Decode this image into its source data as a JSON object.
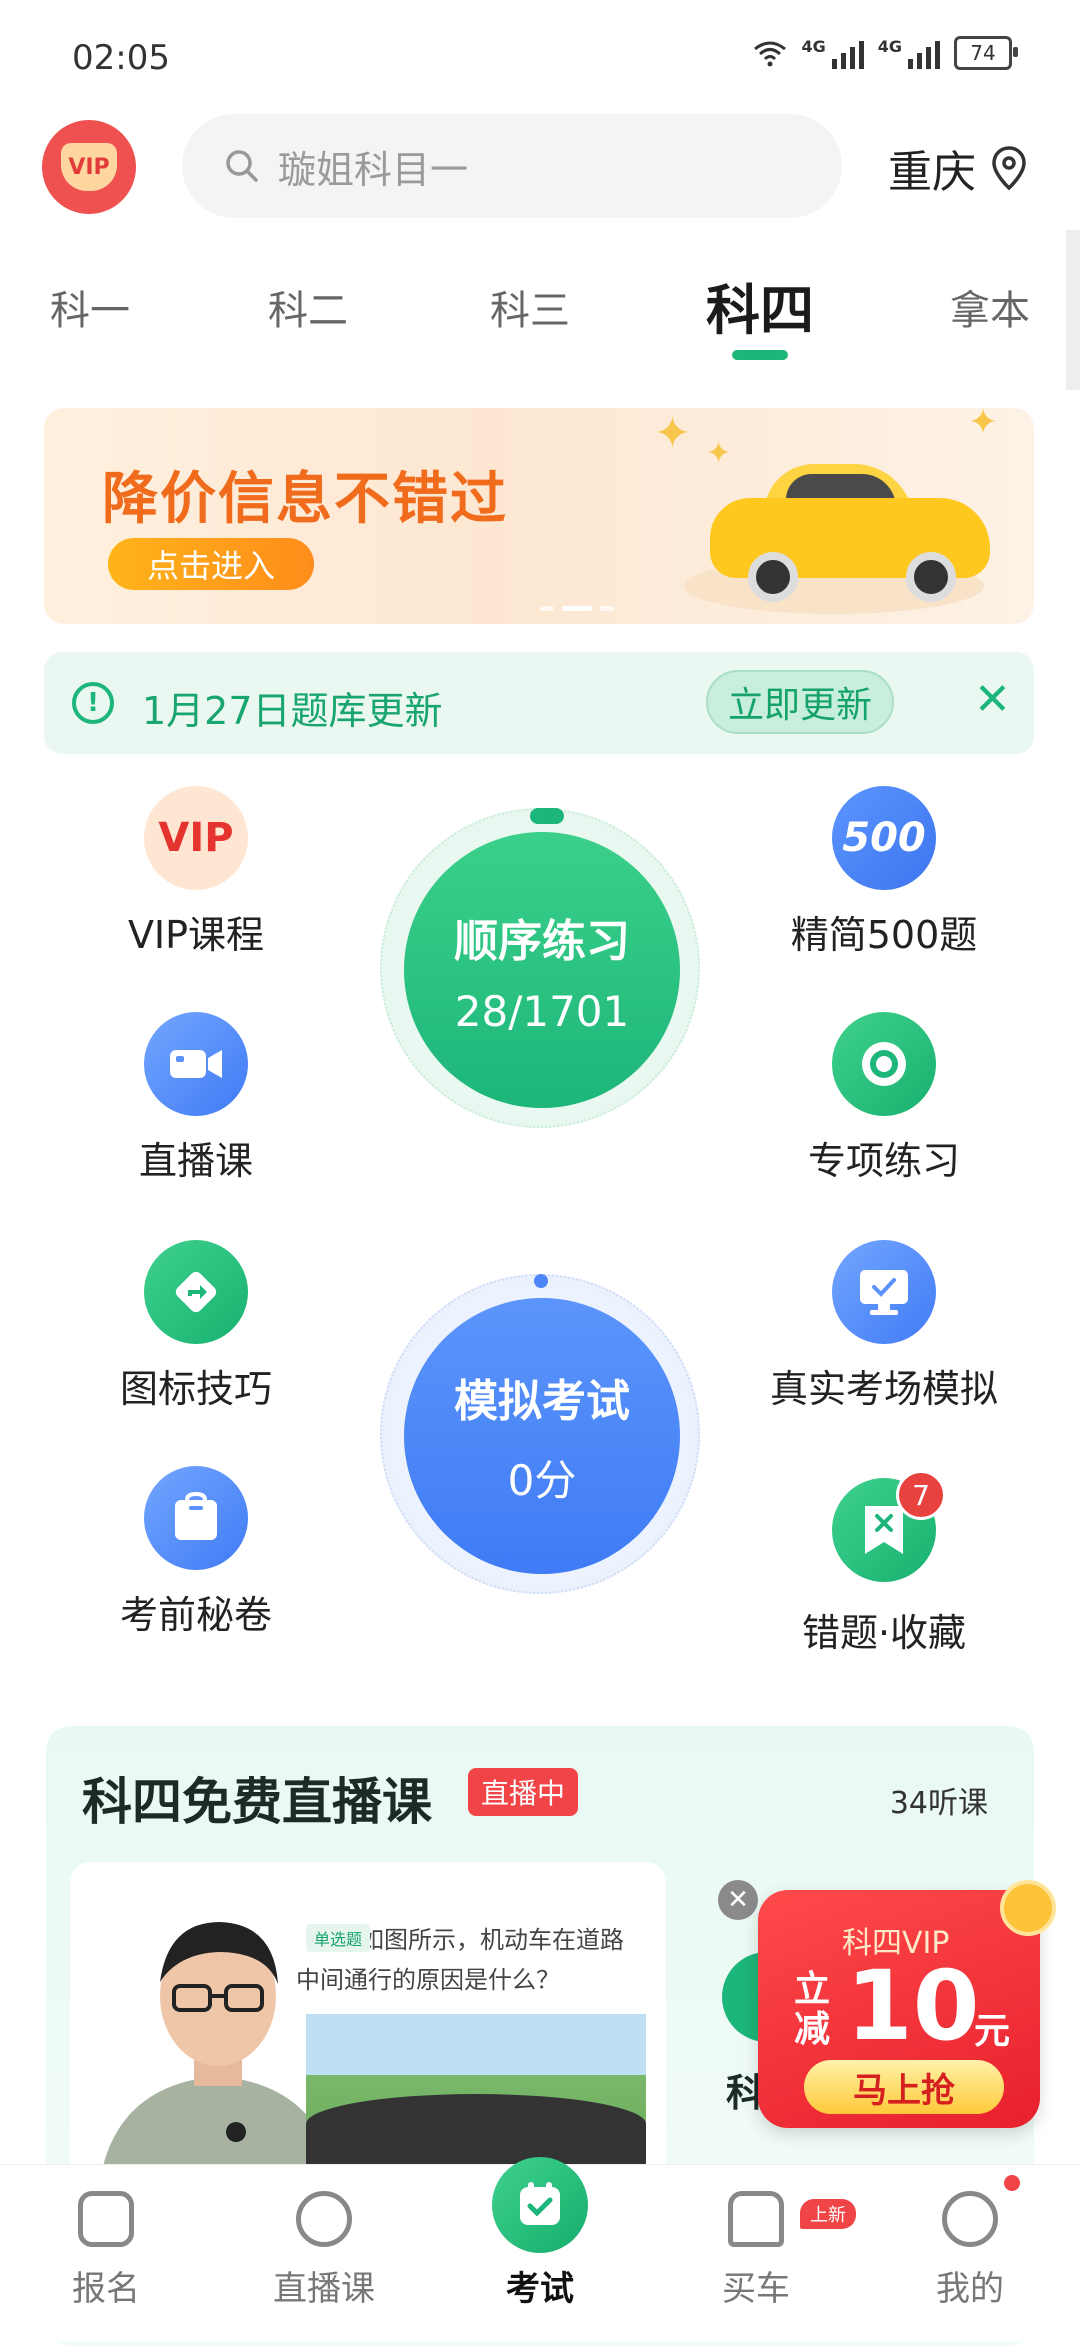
{
  "status_bar": {
    "time": "02:05",
    "network_a": "4G",
    "network_b": "4G",
    "battery": "74"
  },
  "top_bar": {
    "vip_badge": "VIP",
    "search_placeholder": "璇姐科目一",
    "city": "重庆"
  },
  "tabs": [
    {
      "label": "科一",
      "active": false
    },
    {
      "label": "科二",
      "active": false
    },
    {
      "label": "科三",
      "active": false
    },
    {
      "label": "科四",
      "active": true
    },
    {
      "label": "拿本",
      "active": false
    }
  ],
  "banner": {
    "title": "降价信息不错过",
    "button": "点击进入"
  },
  "notice": {
    "text": "1月27日题库更新",
    "button": "立即更新"
  },
  "features": {
    "vip_course": {
      "label": "VIP课程",
      "icon": "VIP"
    },
    "live_class": {
      "label": "直播课"
    },
    "icon_tips": {
      "label": "图标技巧"
    },
    "exam_secret": {
      "label": "考前秘卷"
    },
    "concise_500": {
      "label": "精简500题",
      "icon": "500"
    },
    "special_practice": {
      "label": "专项练习"
    },
    "real_exam_sim": {
      "label": "真实考场模拟"
    },
    "wrong_favorites": {
      "label": "错题·收藏",
      "badge": "7"
    }
  },
  "sequential": {
    "title": "顺序练习",
    "progress": "28/1701"
  },
  "mock_exam": {
    "title": "模拟考试",
    "score": "0分"
  },
  "live_section": {
    "title": "科四免费直播课",
    "tag": "直播中",
    "count": "34听课",
    "card_tag": "单选题",
    "card_question": "如图所示，机动车在道路中间通行的原因是什么？",
    "card2_title": "科"
  },
  "promo": {
    "head": "科四VIP",
    "left": "立减",
    "amount": "10",
    "unit": "元",
    "button": "马上抢"
  },
  "bottom_nav": [
    {
      "label": "报名",
      "active": false
    },
    {
      "label": "直播课",
      "active": false
    },
    {
      "label": "考试",
      "active": true
    },
    {
      "label": "买车",
      "active": false,
      "tag": "上新"
    },
    {
      "label": "我的",
      "active": false
    }
  ],
  "colors": {
    "primary_green": "#1db67a",
    "mock_blue": "#3f7bf5",
    "alert_red": "#f04446",
    "banner_orange": "#f06b1b"
  }
}
